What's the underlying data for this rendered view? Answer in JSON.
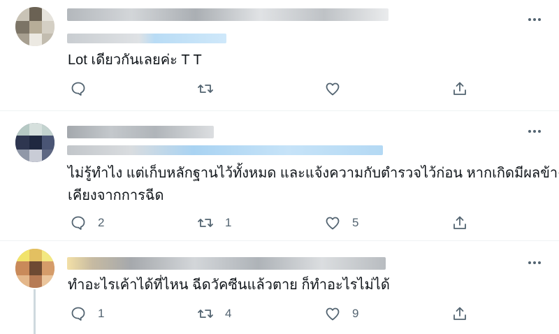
{
  "tweets": [
    {
      "text_lines": [
        "Lot เดียวกันเลยค่ะ T T"
      ],
      "reply_count": "",
      "retweet_count": "",
      "like_count": ""
    },
    {
      "text_lines": [
        "ไม่รู้ทำไง แต่เก็บหลักฐานไว้ทั้งหมด และแจ้งความกับตำรวจไว้ก่อน หากเกิดมีผลข้าง",
        "เคียงจากการฉีด"
      ],
      "reply_count": "2",
      "retweet_count": "1",
      "like_count": "5"
    },
    {
      "text_lines": [
        "ทำอะไรเค้าได้ที่ไหน ฉีดวัคซีนแล้วตาย ก็ทำอะไรไม่ได้"
      ],
      "reply_count": "1",
      "retweet_count": "4",
      "like_count": "9"
    }
  ],
  "icons": {
    "reply": "reply-icon",
    "retweet": "retweet-icon",
    "like": "heart-icon",
    "share": "share-icon",
    "more": "more-options-icon"
  },
  "colors": {
    "text_primary": "#0f1419",
    "text_secondary": "#536471",
    "divider": "#eff3f4",
    "thread_line": "#cfd9de"
  }
}
